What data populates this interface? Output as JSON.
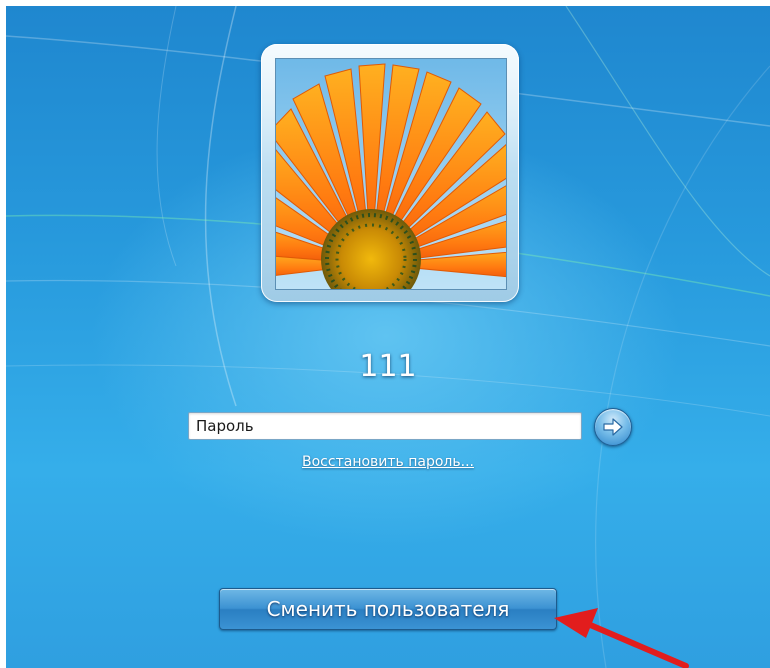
{
  "user": {
    "name": "111"
  },
  "password": {
    "placeholder": "Пароль",
    "value": ""
  },
  "reset_password": {
    "label": "Восстановить пароль..."
  },
  "switch_user": {
    "label": "Сменить пользователя"
  },
  "icons": {
    "submit": "arrow-right-icon",
    "avatar": "flower-picture",
    "annotation": "red-arrow-icon"
  },
  "colors": {
    "background_blue": "#2799dc",
    "button_blue": "#3c92d2",
    "annotation_red": "#e21d1d"
  }
}
